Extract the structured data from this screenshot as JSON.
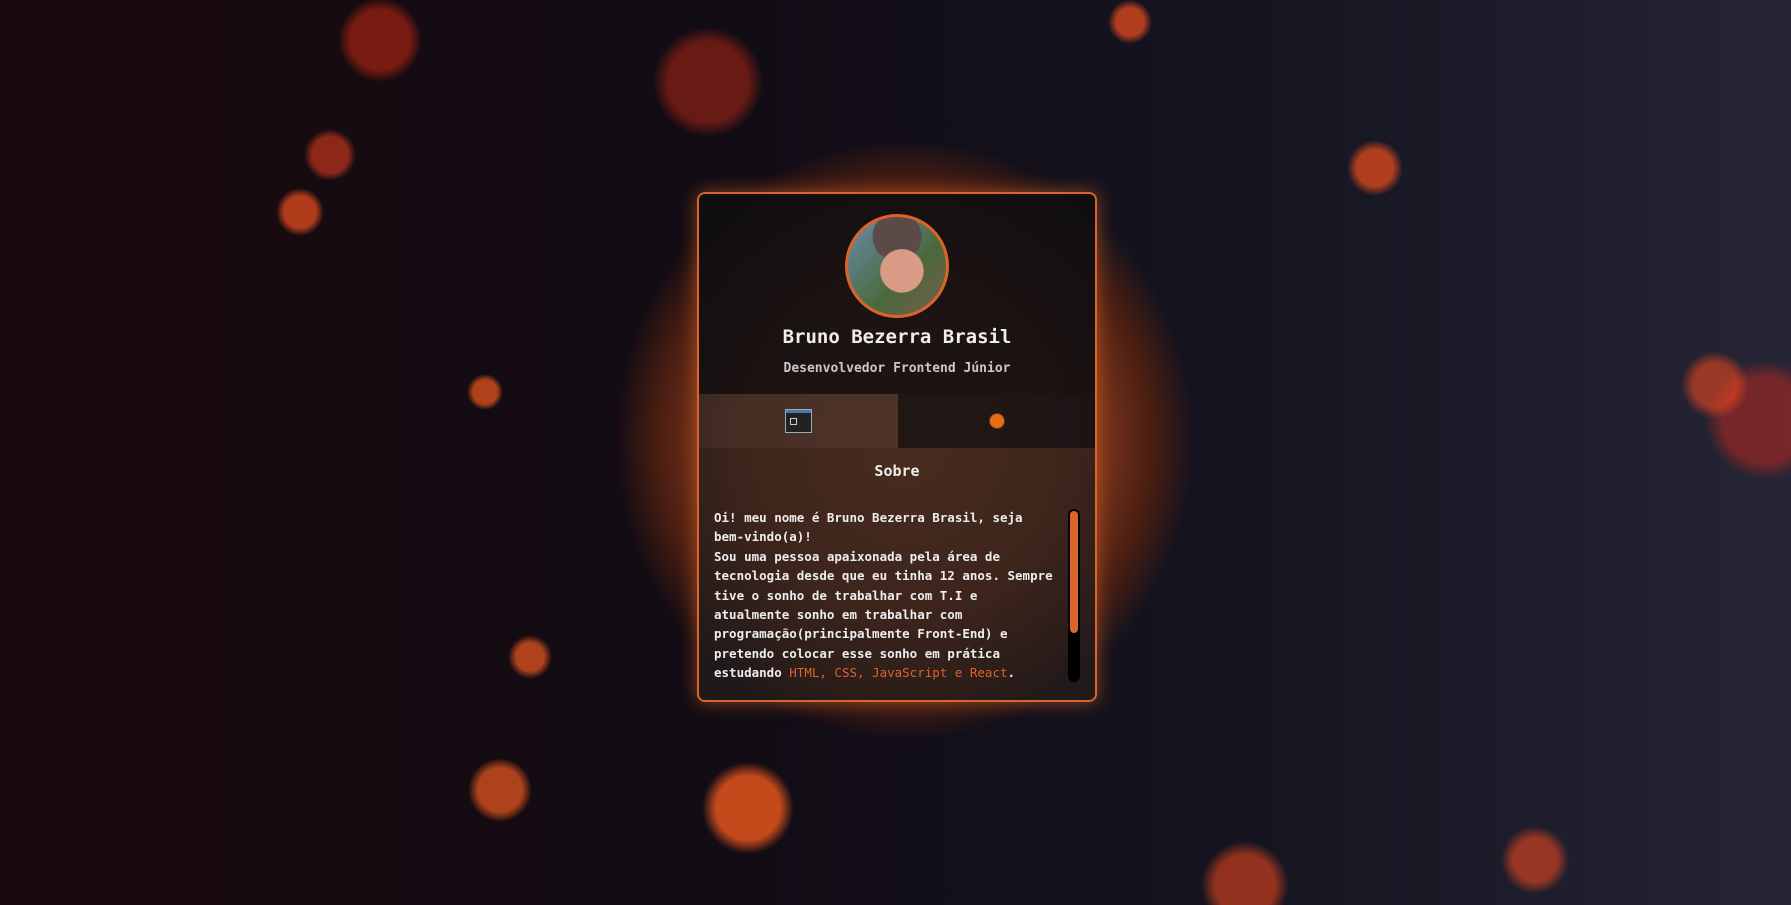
{
  "profile": {
    "name": "Bruno Bezerra Brasil",
    "role": "Desenvolvedor Frontend Júnior"
  },
  "tabs": [
    {
      "icon": "terminal-window-icon",
      "active": true
    },
    {
      "icon": "basketball-icon",
      "active": false
    }
  ],
  "about": {
    "title": "Sobre",
    "text": "Oi! meu nome é Bruno Bezerra Brasil, seja bem-vindo(a)!\nSou uma pessoa apaixonada pela área de tecnologia desde que eu tinha 12 anos. Sempre tive o sonho de trabalhar com T.I e atualmente sonho em trabalhar com programação(principalmente Front-End) e pretendo colocar esse sonho em prática estudando ",
    "highlight": "HTML, CSS, JavaScript e React",
    "end": ".",
    "scroll_fraction": 0.72
  },
  "colors": {
    "accent": "#d9652b"
  }
}
